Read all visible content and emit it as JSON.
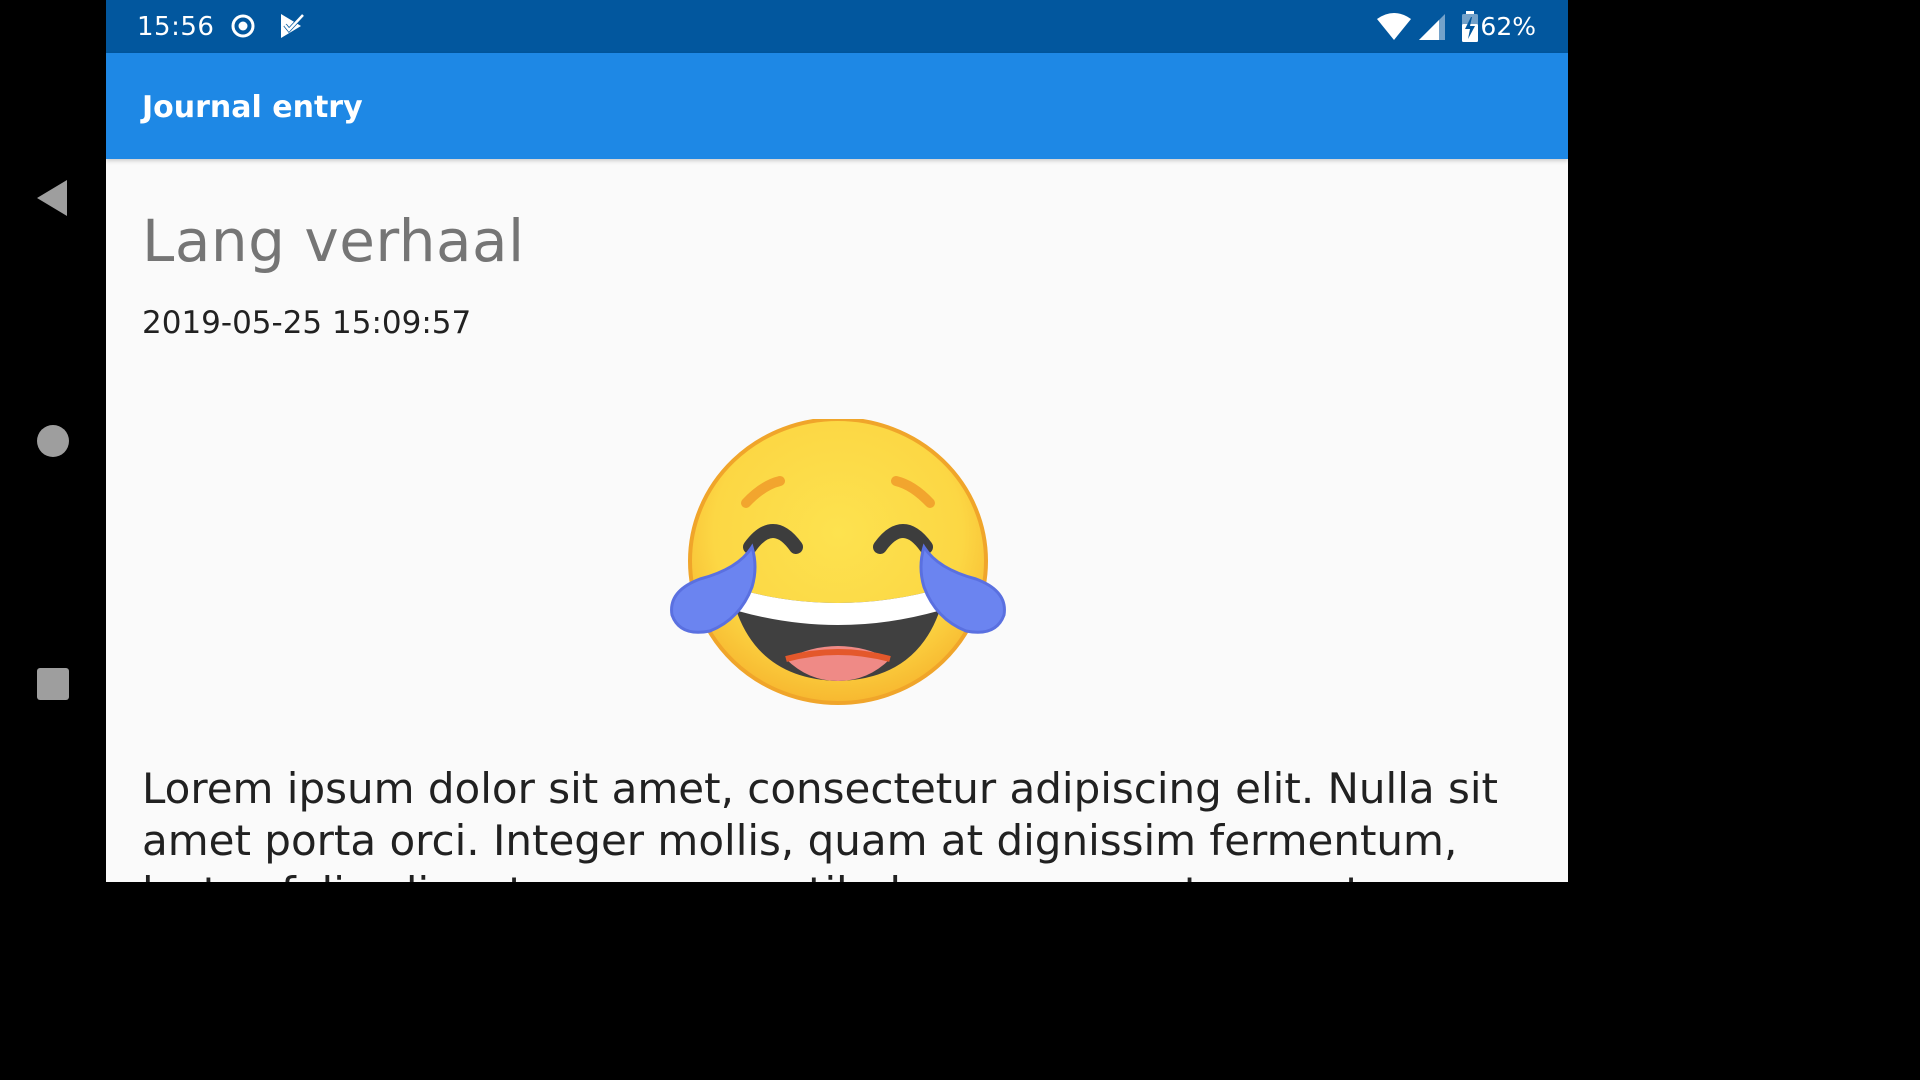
{
  "status_bar": {
    "time": "15:56",
    "battery_percent": "62%",
    "icons": [
      "target-icon",
      "check-flag-icon",
      "wifi-icon",
      "signal-icon",
      "battery-charging-icon"
    ]
  },
  "app_bar": {
    "title": "Journal entry"
  },
  "entry": {
    "title": "Lang verhaal",
    "datetime": "2019-05-25 15:09:57",
    "mood_icon": "face-with-tears-of-joy-icon",
    "body": "Lorem ipsum dolor sit amet, consectetur adipiscing elit. Nulla sit amet porta orci. Integer mollis, quam at dignissim fermentum, lectus felis aliquet augue, a vestibulum massa ante a metus. Pellentesque sapien."
  },
  "navigation": {
    "buttons": [
      "back-icon",
      "home-icon",
      "recents-icon"
    ]
  }
}
